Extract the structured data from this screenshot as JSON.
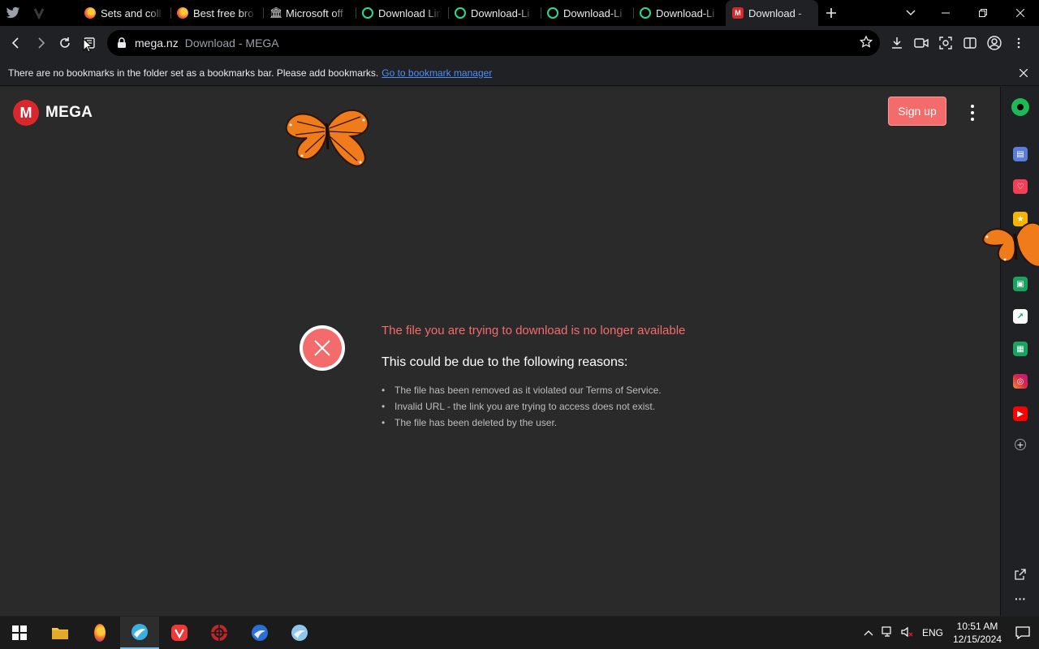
{
  "tabs": [
    {
      "title": "Sets and coll",
      "favicon": "firefox-icon"
    },
    {
      "title": "Best free bro",
      "favicon": "firefox-icon"
    },
    {
      "title": "Microsoft off",
      "favicon": "building-icon"
    },
    {
      "title": "Download Lin",
      "favicon": "ring-icon"
    },
    {
      "title": "Download-Li",
      "favicon": "ring-icon"
    },
    {
      "title": "Download-Li",
      "favicon": "ring-icon"
    },
    {
      "title": "Download-Li",
      "favicon": "ring-icon"
    },
    {
      "title": "Download - ",
      "favicon": "mega-icon",
      "active": true
    }
  ],
  "omnibox": {
    "domain": "mega.nz",
    "page_title": "Download - MEGA"
  },
  "bookmarks_bar": {
    "message": "There are no bookmarks in the folder set as a bookmarks bar. Please add bookmarks.",
    "link": "Go to bookmark manager"
  },
  "mega": {
    "logo_letter": "M",
    "logo_word": "MEGA",
    "signup_label": "Sign up",
    "error_title": "The file you are trying to download is no longer available",
    "error_subtitle": "This could be due to the following reasons:",
    "reasons": [
      "The file has been removed as it violated our Terms of Service.",
      "Invalid URL - the link you are trying to access does not exist.",
      "The file has been deleted by the user."
    ]
  },
  "taskbar": {
    "language": "ENG",
    "time": "10:51 AM",
    "date": "12/15/2024"
  },
  "colors": {
    "accent": "#f46b6b",
    "mega_red": "#d9272e",
    "page_bg": "#2a2a2b"
  }
}
